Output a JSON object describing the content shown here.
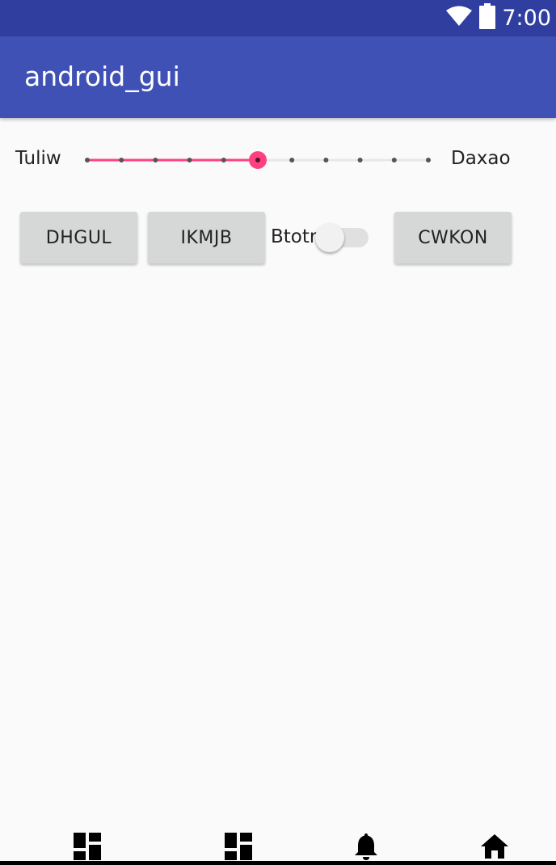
{
  "status_bar": {
    "time": "7:00",
    "icons": [
      "wifi-icon",
      "battery-icon"
    ],
    "color": "#303f9f"
  },
  "app_bar": {
    "title": "android_gui",
    "color": "#3f51b5"
  },
  "slider": {
    "left_label": "Tuliw",
    "right_label": "Daxao",
    "steps": 10,
    "value": 5,
    "accent": "#ff4081",
    "track_color": "#e8e8e8",
    "tick_color": "#555555"
  },
  "buttons": {
    "first": "DHGUL",
    "second": "IKMJB",
    "third": "CWKON"
  },
  "switch": {
    "label": "Btotr",
    "on": false
  },
  "bottom_nav": {
    "items": [
      "dashboard-icon",
      "dashboard-icon",
      "notifications-icon",
      "home-icon"
    ]
  }
}
